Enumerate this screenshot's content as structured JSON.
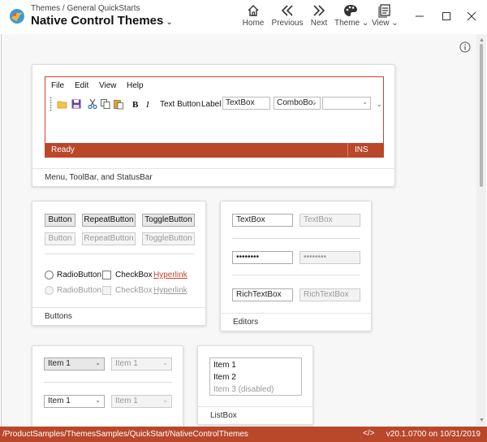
{
  "header": {
    "breadcrumb": "Themes / General QuickStarts",
    "title": "Native Control Themes",
    "title_caret": "⌄",
    "nav": [
      {
        "label": "Home",
        "icon": "home-icon"
      },
      {
        "label": "Previous",
        "icon": "previous-icon"
      },
      {
        "label": "Next",
        "icon": "next-icon"
      },
      {
        "label": "Theme",
        "icon": "palette-icon"
      },
      {
        "label": "View",
        "icon": "view-icon"
      }
    ],
    "theme_caret": "⌄",
    "view_caret": "⌄"
  },
  "colors": {
    "accent": "#b9472a",
    "link": "#c4472b"
  },
  "menu_demo": {
    "menus": [
      "File",
      "Edit",
      "View",
      "Help"
    ],
    "toolbar": {
      "bold": "B",
      "italic": "I",
      "text_button": "Text Button",
      "label": "Label",
      "textbox_value": "TextBox",
      "combobox_value": "ComboBo:",
      "combo_arrow": "⌄",
      "overflow": "⌄"
    },
    "status": {
      "ready": "Ready",
      "ins": "INS"
    },
    "caption": "Menu, ToolBar, and StatusBar"
  },
  "buttons_card": {
    "button": "Button",
    "repeat_button": "RepeatButton",
    "toggle_button": "ToggleButton",
    "radio_button": "RadioButton",
    "checkbox": "CheckBox",
    "hyperlink": "Hyperlink",
    "caption": "Buttons"
  },
  "editors_card": {
    "textbox": "TextBox",
    "password": "••••••••",
    "rich_textbox": "RichTextBox",
    "caption": "Editors"
  },
  "combo_card": {
    "item": "Item 1",
    "arrow": "⌄"
  },
  "listbox_card": {
    "items": [
      "Item 1",
      "Item 2",
      "Item 3 (disabled)"
    ],
    "caption": "ListBox"
  },
  "app_status": {
    "path": "/ProductSamples/ThemesSamples/QuickStart/NativeControlThemes",
    "code_icon": "</>",
    "version": "v20.1.0700 on 10/31/2019"
  }
}
